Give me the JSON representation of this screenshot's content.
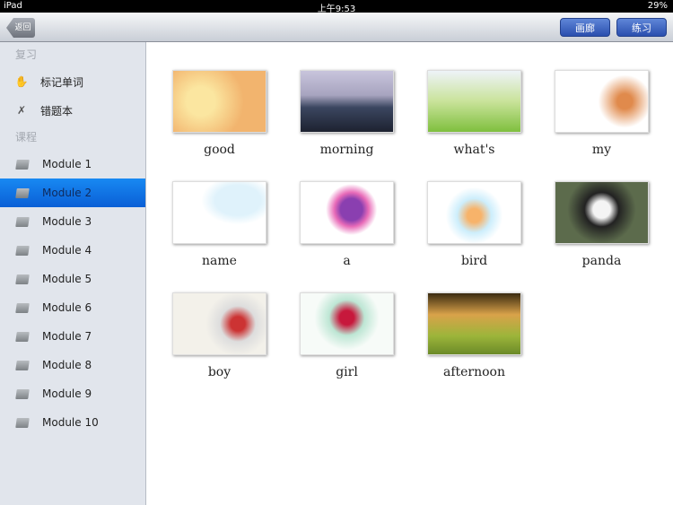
{
  "status": {
    "device": "iPad",
    "time": "上午9:53",
    "battery": "29%"
  },
  "nav": {
    "back": "返回",
    "gallery": "画廊",
    "practice": "练习"
  },
  "sidebar": {
    "review_header": "复习",
    "review_items": [
      {
        "label": "标记单词",
        "icon": "hand-icon"
      },
      {
        "label": "错题本",
        "icon": "mistake-book-icon"
      }
    ],
    "course_header": "课程",
    "modules": [
      "Module 1",
      "Module 2",
      "Module 3",
      "Module 4",
      "Module 5",
      "Module 6",
      "Module 7",
      "Module 8",
      "Module 9",
      "Module 10"
    ],
    "selected": "Module 2"
  },
  "words": [
    "good",
    "morning",
    "what's",
    "my",
    "name",
    "a",
    "bird",
    "panda",
    "boy",
    "girl",
    "afternoon"
  ]
}
